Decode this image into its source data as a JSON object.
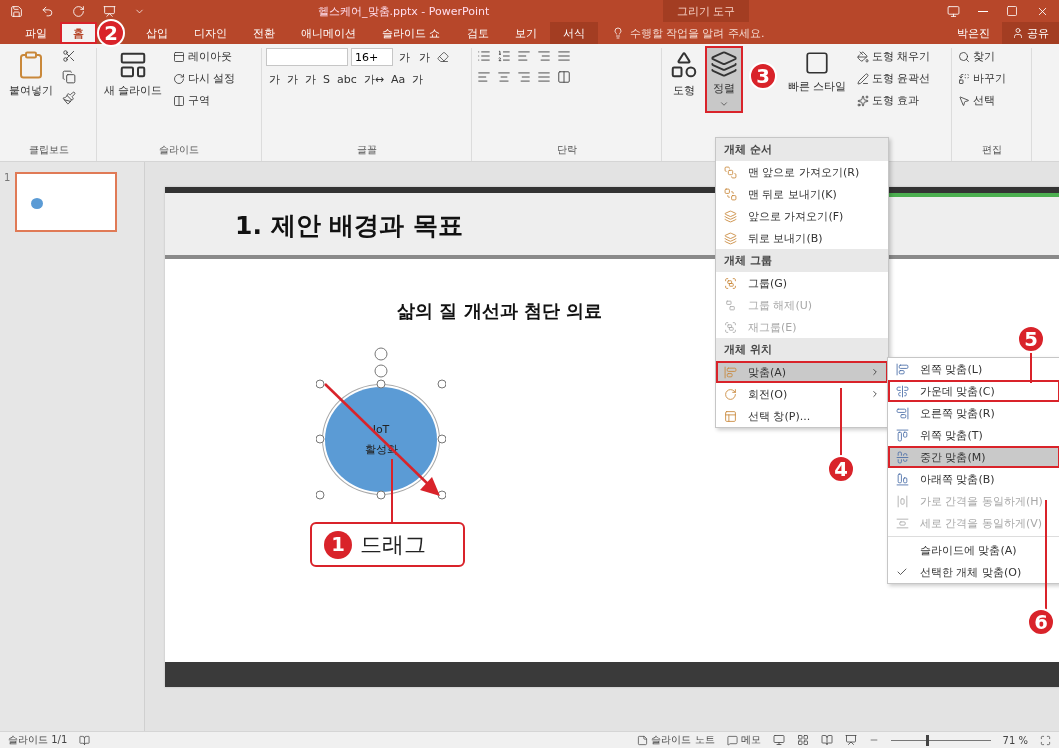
{
  "window": {
    "title": "헬스케어_맞춤.pptx - PowerPoint",
    "context_group": "그리기 도구"
  },
  "tabs": [
    {
      "label": "파일",
      "selected": false,
      "annotated": false,
      "kind": "normal"
    },
    {
      "label": "홈",
      "selected": true,
      "annotated": true,
      "kind": "normal"
    },
    {
      "label": "삽입",
      "selected": false,
      "annotated": false,
      "kind": "normal"
    },
    {
      "label": "디자인",
      "selected": false,
      "annotated": false,
      "kind": "normal"
    },
    {
      "label": "전환",
      "selected": false,
      "annotated": false,
      "kind": "normal"
    },
    {
      "label": "애니메이션",
      "selected": false,
      "annotated": false,
      "kind": "normal"
    },
    {
      "label": "슬라이드 쇼",
      "selected": false,
      "annotated": false,
      "kind": "normal"
    },
    {
      "label": "검토",
      "selected": false,
      "annotated": false,
      "kind": "normal"
    },
    {
      "label": "보기",
      "selected": false,
      "annotated": false,
      "kind": "normal"
    },
    {
      "label": "서식",
      "selected": false,
      "annotated": false,
      "kind": "context"
    }
  ],
  "tell_me": {
    "placeholder": "수행할 작업을 알려 주세요."
  },
  "user": "박은진",
  "share": "공유",
  "ribbon": [
    {
      "kind": "clipboard",
      "label": "클립보드",
      "paste": "붙여넣기"
    },
    {
      "kind": "slides",
      "label": "슬라이드",
      "new_slide": "새 슬라이드",
      "items": [
        "레이아웃",
        "다시 설정",
        "구역"
      ]
    },
    {
      "kind": "font",
      "label": "글꼴",
      "font_size": "16+",
      "size_buttons": [
        "가",
        "가"
      ],
      "format_buttons": [
        "가",
        "가",
        "가",
        "S",
        "abc",
        "가↔",
        "Aa",
        "가"
      ]
    },
    {
      "kind": "paragraph",
      "label": "단락"
    },
    {
      "kind": "drawing",
      "shapes": "도형",
      "arrange": "정렬",
      "arrange_annotated": true,
      "quick_styles": "빠른 스타일",
      "items": [
        "도형 채우기",
        "도형 윤곽선",
        "도형 효과"
      ]
    },
    {
      "kind": "editing",
      "label": "편집",
      "items": [
        "찾기",
        "바꾸기",
        "선택"
      ]
    }
  ],
  "arrange_menu": [
    {
      "header": "개체 순서",
      "items": [
        {
          "label": "맨 앞으로 가져오기(R)",
          "disabled": false,
          "highlighted": false,
          "annotated": false,
          "submenu": false
        },
        {
          "label": "맨 뒤로 보내기(K)",
          "disabled": false,
          "highlighted": false,
          "annotated": false,
          "submenu": false
        },
        {
          "label": "앞으로 가져오기(F)",
          "disabled": false,
          "highlighted": false,
          "annotated": false,
          "submenu": false
        },
        {
          "label": "뒤로 보내기(B)",
          "disabled": false,
          "highlighted": false,
          "annotated": false,
          "submenu": false
        }
      ]
    },
    {
      "header": "개체 그룹",
      "items": [
        {
          "label": "그룹(G)",
          "disabled": false,
          "highlighted": false,
          "annotated": false,
          "submenu": false
        },
        {
          "label": "그룹 해제(U)",
          "disabled": true,
          "highlighted": false,
          "annotated": false,
          "submenu": false
        },
        {
          "label": "재그룹(E)",
          "disabled": true,
          "highlighted": false,
          "annotated": false,
          "submenu": false
        }
      ]
    },
    {
      "header": "개체 위치",
      "items": [
        {
          "label": "맞춤(A)",
          "disabled": false,
          "highlighted": true,
          "annotated": true,
          "submenu": true
        },
        {
          "label": "회전(O)",
          "disabled": false,
          "highlighted": false,
          "annotated": false,
          "submenu": true
        },
        {
          "label": "선택 창(P)...",
          "disabled": false,
          "highlighted": false,
          "annotated": false,
          "submenu": false
        }
      ]
    }
  ],
  "align_submenu": [
    {
      "label": "왼쪽 맞춤(L)",
      "disabled": false,
      "highlighted": false,
      "annotated": false,
      "checked": false,
      "separator_before": false
    },
    {
      "label": "가운데 맞춤(C)",
      "disabled": false,
      "highlighted": false,
      "annotated": true,
      "checked": false,
      "separator_before": false
    },
    {
      "label": "오른쪽 맞춤(R)",
      "disabled": false,
      "highlighted": false,
      "annotated": false,
      "checked": false,
      "separator_before": false
    },
    {
      "label": "위쪽 맞춤(T)",
      "disabled": false,
      "highlighted": false,
      "annotated": false,
      "checked": false,
      "separator_before": false
    },
    {
      "label": "중간 맞춤(M)",
      "disabled": false,
      "highlighted": true,
      "annotated": true,
      "checked": false,
      "separator_before": false
    },
    {
      "label": "아래쪽 맞춤(B)",
      "disabled": false,
      "highlighted": false,
      "annotated": false,
      "checked": false,
      "separator_before": false
    },
    {
      "label": "가로 간격을 동일하게(H)",
      "disabled": true,
      "highlighted": false,
      "annotated": false,
      "checked": false,
      "separator_before": false
    },
    {
      "label": "세로 간격을 동일하게(V)",
      "disabled": true,
      "highlighted": false,
      "annotated": false,
      "checked": false,
      "separator_before": false
    },
    {
      "label": "슬라이드에 맞춤(A)",
      "disabled": false,
      "highlighted": false,
      "annotated": false,
      "checked": false,
      "separator_before": true
    },
    {
      "label": "선택한 개체 맞춤(O)",
      "disabled": false,
      "highlighted": false,
      "annotated": false,
      "checked": true,
      "separator_before": false
    }
  ],
  "thumbnails": [
    {
      "number": "1",
      "selected": true
    }
  ],
  "slide": {
    "title": "1. 제안 배경과 목표",
    "subtitle": "삶의 질 개선과 첨단 의료",
    "shape": {
      "text": "IoT\n활성화",
      "selected": true
    }
  },
  "annotations": [
    {
      "number": "1",
      "text": "드래그"
    },
    {
      "number": "2"
    },
    {
      "number": "3"
    },
    {
      "number": "4"
    },
    {
      "number": "5"
    },
    {
      "number": "6"
    }
  ],
  "status_bar": {
    "slide": "슬라이드 1/1",
    "notes": "슬라이드 노트",
    "comments": "메모",
    "zoom": {
      "level": 0.36,
      "reading": "71 %"
    }
  }
}
